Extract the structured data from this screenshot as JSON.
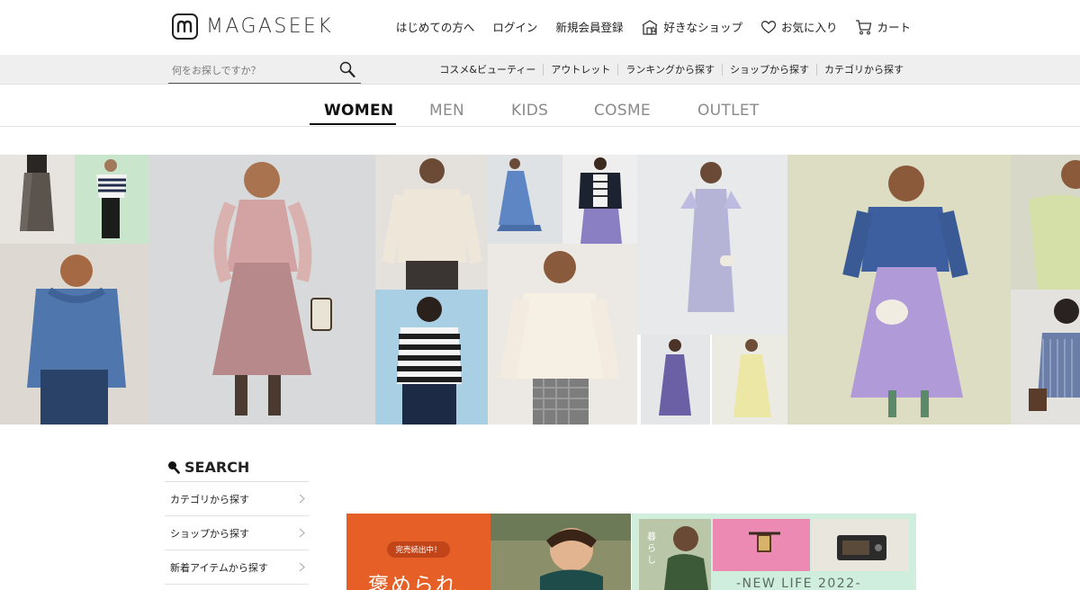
{
  "brand": {
    "name": "MAGASEEK"
  },
  "top_nav": {
    "first_time": "はじめての方へ",
    "login": "ログイン",
    "register": "新規会員登録",
    "favorite_shops": "好きなショップ",
    "favorites": "お気に入り",
    "cart": "カート"
  },
  "search": {
    "placeholder": "何をお探しですか？"
  },
  "sub_links": [
    "コスメ&ビューティー",
    "アウトレット",
    "ランキングから探す",
    "ショップから探す",
    "カテゴリから探す"
  ],
  "tabs": {
    "women": "WOMEN",
    "men": "MEN",
    "kids": "KIDS",
    "cosme": "COSME",
    "outlet": "OUTLET",
    "active": "WOMEN"
  },
  "sidebar": {
    "title": "SEARCH",
    "items": [
      "カテゴリから探す",
      "ショップから探す",
      "新着アイテムから探す"
    ]
  },
  "banners": {
    "a_badge": "完売続出中！",
    "a_title": "褒められ",
    "c_vertical": "暮らし",
    "c_title": "-NEW LIFE 2022-"
  },
  "colors": {
    "text": "#222222",
    "subbar": "#efefef",
    "banner_orange": "#e55f26",
    "banner_mint": "#cfeedd"
  }
}
